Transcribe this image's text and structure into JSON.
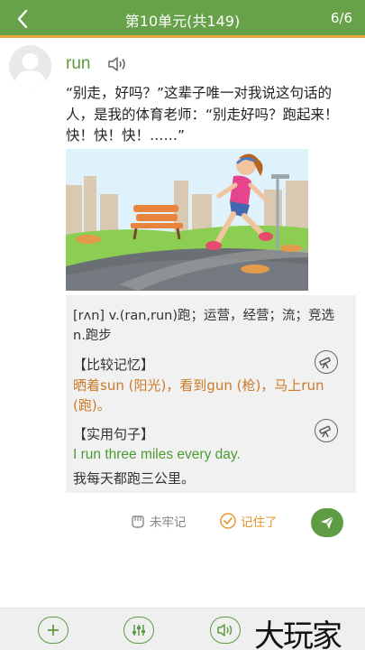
{
  "header": {
    "title": "第10单元(共149)",
    "count": "6/6"
  },
  "entry": {
    "word": "run",
    "story": "“别走，好吗？”这辈子唯一对我说这句话的人，是我的体育老师：“别走好吗？跑起来！快！快！快！……”"
  },
  "card": {
    "phonetic": "[rʌn] v.(ran,run)跑；运营，经营；流；竞选 n.跑步",
    "compare_label": "【比较记忆】",
    "compare_text": "晒着sun (阳光)，看到gun (枪)，马上run (跑)。",
    "sentence_label": "【实用句子】",
    "sentence_en": "I run three miles every day.",
    "sentence_zh": "我每天都跑三公里。"
  },
  "actions": {
    "not_remember": "未牢记",
    "remembered": "记住了"
  },
  "watermark": "大玩家",
  "icons": {
    "back": "back-arrow-icon",
    "avatar": "user-avatar-icon",
    "speaker": "speaker-icon",
    "telescope": "telescope-icon",
    "fist": "fist-icon",
    "check": "check-circle-icon",
    "send": "send-icon",
    "add": "plus-icon",
    "settings": "sliders-icon",
    "audio": "speaker-icon"
  },
  "colors": {
    "header": "#67a14a",
    "accent_orange": "#e8a23b",
    "green_text": "#4d9b35",
    "orange_text": "#cc7a28"
  }
}
